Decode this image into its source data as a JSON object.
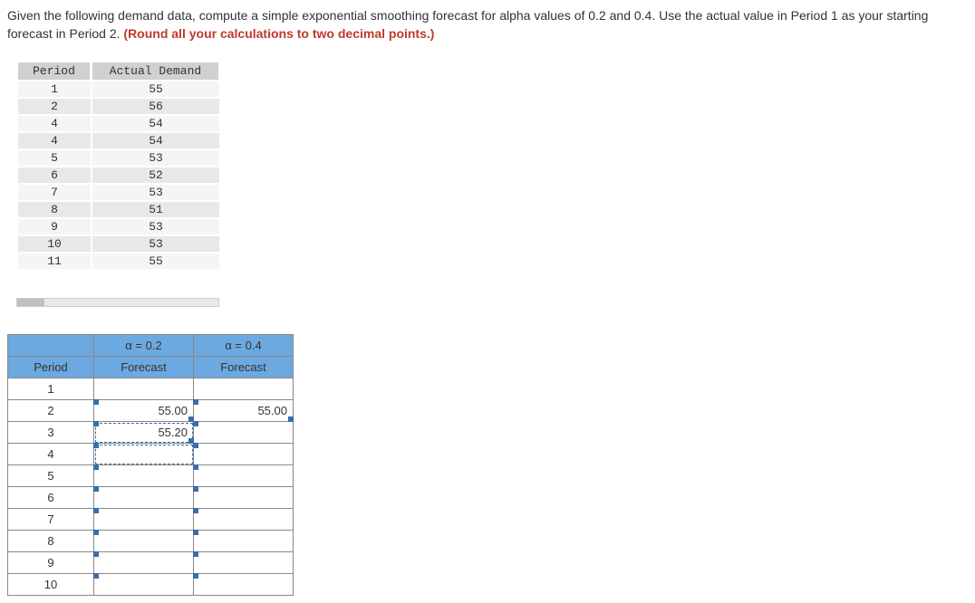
{
  "question": {
    "part1": "Given the following demand data, compute a simple exponential smoothing forecast for alpha values of 0.2 and 0.4. Use the actual value in Period 1 as your starting forecast in Period 2. ",
    "part2_bold": "(Round all your calculations to two decimal points.)"
  },
  "data_table": {
    "headers": {
      "period": "Period",
      "demand": "Actual Demand"
    },
    "rows": [
      {
        "period": "1",
        "demand": "55"
      },
      {
        "period": "2",
        "demand": "56"
      },
      {
        "period": "4",
        "demand": "54"
      },
      {
        "period": "4",
        "demand": "54"
      },
      {
        "period": "5",
        "demand": "53"
      },
      {
        "period": "6",
        "demand": "52"
      },
      {
        "period": "7",
        "demand": "53"
      },
      {
        "period": "8",
        "demand": "51"
      },
      {
        "period": "9",
        "demand": "53"
      },
      {
        "period": "10",
        "demand": "53"
      },
      {
        "period": "11",
        "demand": "55"
      }
    ]
  },
  "forecast_table": {
    "alpha_headers": {
      "a02": "α = 0.2",
      "a04": "α = 0.4"
    },
    "col_headers": {
      "period": "Period",
      "forecast": "Forecast"
    },
    "rows": [
      {
        "period": "1",
        "a02": "",
        "a04": ""
      },
      {
        "period": "2",
        "a02": "55.00",
        "a04": "55.00"
      },
      {
        "period": "3",
        "a02": "55.20",
        "a04": ""
      },
      {
        "period": "4",
        "a02": "",
        "a04": ""
      },
      {
        "period": "5",
        "a02": "",
        "a04": ""
      },
      {
        "period": "6",
        "a02": "",
        "a04": ""
      },
      {
        "period": "7",
        "a02": "",
        "a04": ""
      },
      {
        "period": "8",
        "a02": "",
        "a04": ""
      },
      {
        "period": "9",
        "a02": "",
        "a04": ""
      },
      {
        "period": "10",
        "a02": "",
        "a04": ""
      }
    ]
  }
}
